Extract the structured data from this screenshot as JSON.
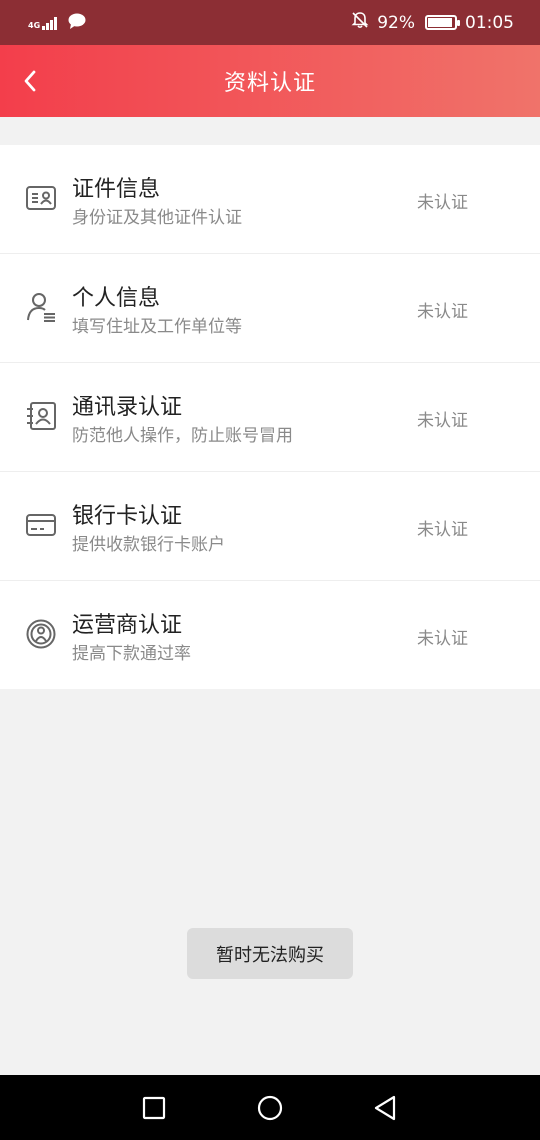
{
  "status_bar": {
    "network": "4G",
    "battery_percent_text": "92%",
    "battery_level": 0.92,
    "time": "01:05",
    "icons": [
      "signal-icon",
      "chat-bubble-icon",
      "mute-bell-icon",
      "battery-icon"
    ]
  },
  "header": {
    "title": "资料认证",
    "back_icon": "chevron-left-icon",
    "background_gradient": [
      "#f33e4b",
      "#f0736a"
    ]
  },
  "items": [
    {
      "title": "证件信息",
      "subtitle": "身份证及其他证件认证",
      "status": "未认证",
      "icon": "id-card-icon"
    },
    {
      "title": "个人信息",
      "subtitle": "填写住址及工作单位等",
      "status": "未认证",
      "icon": "person-icon"
    },
    {
      "title": "通讯录认证",
      "subtitle": "防范他人操作，防止账号冒用",
      "status": "未认证",
      "icon": "contacts-icon"
    },
    {
      "title": "银行卡认证",
      "subtitle": "提供收款银行卡账户",
      "status": "未认证",
      "icon": "bank-card-icon"
    },
    {
      "title": "运营商认证",
      "subtitle": "提高下款通过率",
      "status": "未认证",
      "icon": "carrier-icon"
    }
  ],
  "toast": {
    "text": "暂时无法购买"
  },
  "nav": {
    "icons": [
      "recent-apps-icon",
      "home-icon",
      "back-icon"
    ]
  }
}
